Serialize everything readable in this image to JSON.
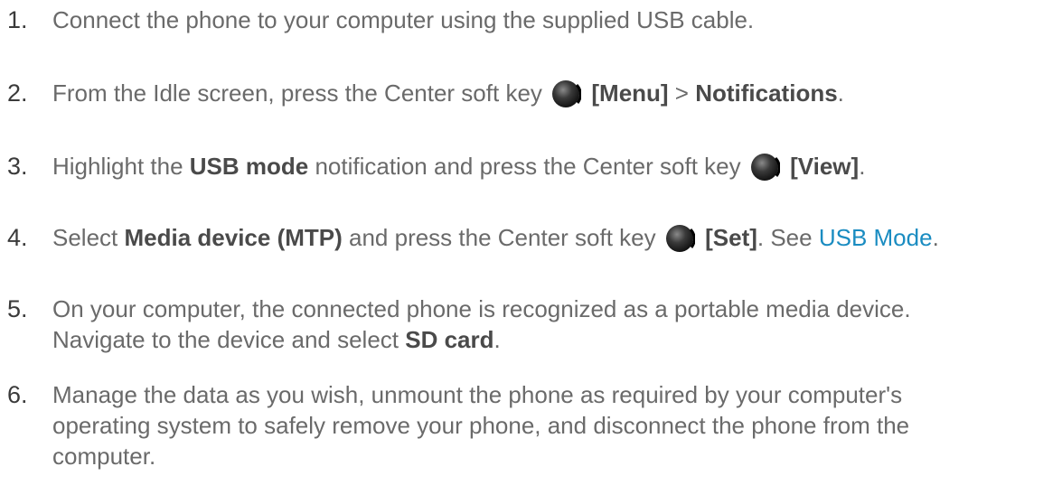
{
  "steps": [
    {
      "num": "1.",
      "text_a": "Connect the phone to your computer using the supplied USB cable."
    },
    {
      "num": "2.",
      "text_a": "From the Idle screen, press the Center soft key",
      "key_icon": "center-soft-key-icon",
      "bold_a": "[Menu]",
      "text_b": " > ",
      "bold_b": "Notifications",
      "text_c": "."
    },
    {
      "num": "3.",
      "text_a": "Highlight the ",
      "bold_a": "USB mode",
      "text_b": " notification and press the Center soft key",
      "key_icon": "center-soft-key-icon",
      "bold_b": "[View]",
      "text_c": "."
    },
    {
      "num": "4.",
      "text_a": "Select ",
      "bold_a": "Media device (MTP)",
      "text_b": " and press the Center soft key",
      "key_icon": "center-soft-key-icon",
      "bold_b": "[Set]",
      "text_c": ". See ",
      "link": "USB Mode",
      "text_d": "."
    },
    {
      "num": "5.",
      "line1": "On your computer, the connected phone is recognized as a portable media device.",
      "line2_a": "Navigate to the device and select ",
      "bold_a": "SD card",
      "line2_b": "."
    },
    {
      "num": "6.",
      "line1": "Manage the data as you wish, unmount the phone as required by your computer's",
      "line2": "operating system to safely remove your phone, and disconnect the phone from the",
      "line3": "computer."
    }
  ],
  "colors": {
    "text": "#6a6a6a",
    "bold": "#4a4a4a",
    "number": "#3a3a3a",
    "link": "#1a8cc1"
  }
}
